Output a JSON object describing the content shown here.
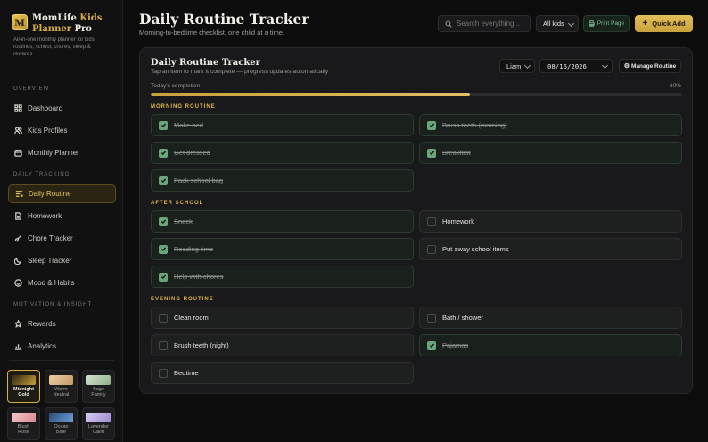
{
  "brand": {
    "name_main": "MomLife",
    "name_gold": "Kids",
    "name_line2_gold": "Planner",
    "name_line2": " Pro",
    "logo_letter": "M",
    "tagline": "All-in-one monthly planner for kids routines, school, chores, sleep & rewards"
  },
  "sidebar": {
    "sections": {
      "overview": "Overview",
      "daily": "Daily Tracking",
      "motivation": "Motivation & Insight"
    },
    "items": [
      {
        "label": "Dashboard",
        "icon": "grid-icon"
      },
      {
        "label": "Kids Profiles",
        "icon": "users-icon"
      },
      {
        "label": "Monthly Planner",
        "icon": "calendar-icon"
      },
      {
        "label": "Daily Routine",
        "icon": "list-icon",
        "active": true
      },
      {
        "label": "Homework",
        "icon": "document-icon"
      },
      {
        "label": "Chore Tracker",
        "icon": "broom-icon"
      },
      {
        "label": "Sleep Tracker",
        "icon": "moon-icon"
      },
      {
        "label": "Mood & Habits",
        "icon": "smile-icon"
      },
      {
        "label": "Rewards",
        "icon": "star-icon"
      },
      {
        "label": "Analytics",
        "icon": "bar-chart-icon"
      }
    ],
    "themes": [
      {
        "label1": "Midnight",
        "label2": "Gold",
        "color1": "#2b2410",
        "color2": "#c9a13c",
        "active": true
      },
      {
        "label1": "Warm",
        "label2": "Neutral",
        "color1": "#e9cfa6",
        "color2": "#c69a63"
      },
      {
        "label1": "Sage",
        "label2": "Family",
        "color1": "#d2e2cf",
        "color2": "#8fb08a"
      },
      {
        "label1": "Blush",
        "label2": "Rose",
        "color1": "#f3c9cd",
        "color2": "#d9878f"
      },
      {
        "label1": "Ocean",
        "label2": "Blue",
        "color1": "#2a4a78",
        "color2": "#6f9fd8"
      },
      {
        "label1": "Lavender",
        "label2": "Calm",
        "color1": "#d6ccf0",
        "color2": "#9d8ad0"
      }
    ]
  },
  "header": {
    "title": "Daily Routine Tracker",
    "subtitle": "Morning-to-bedtime checklist, one child at a time.",
    "search_placeholder": "Search everything...",
    "kids_filter": "All kids",
    "print_label": "Print Page",
    "quick_add_label": "Quick Add"
  },
  "card": {
    "title": "Daily Routine Tracker",
    "subtitle": "Tap an item to mark it complete — progress updates automatically",
    "child": "Liam",
    "date": "08/16/2026",
    "manage_label": "Manage Routine",
    "progress_label": "Today's completion",
    "progress_text": "60%",
    "progress_fraction": 0.6
  },
  "groups": [
    {
      "label": "Morning Routine",
      "tasks": [
        {
          "label": "Make bed",
          "done": true
        },
        {
          "label": "Brush teeth (morning)",
          "done": true
        },
        {
          "label": "Get dressed",
          "done": true
        },
        {
          "label": "Breakfast",
          "done": true
        },
        {
          "label": "Pack school bag",
          "done": true
        }
      ]
    },
    {
      "label": "After School",
      "tasks": [
        {
          "label": "Snack",
          "done": true
        },
        {
          "label": "Homework",
          "done": false
        },
        {
          "label": "Reading time",
          "done": true
        },
        {
          "label": "Put away school items",
          "done": false
        },
        {
          "label": "Help with chores",
          "done": true
        }
      ]
    },
    {
      "label": "Evening Routine",
      "tasks": [
        {
          "label": "Clean room",
          "done": false
        },
        {
          "label": "Bath / shower",
          "done": false
        },
        {
          "label": "Brush teeth (night)",
          "done": false
        },
        {
          "label": "Pajamas",
          "done": true
        },
        {
          "label": "Bedtime",
          "done": false
        }
      ]
    }
  ]
}
